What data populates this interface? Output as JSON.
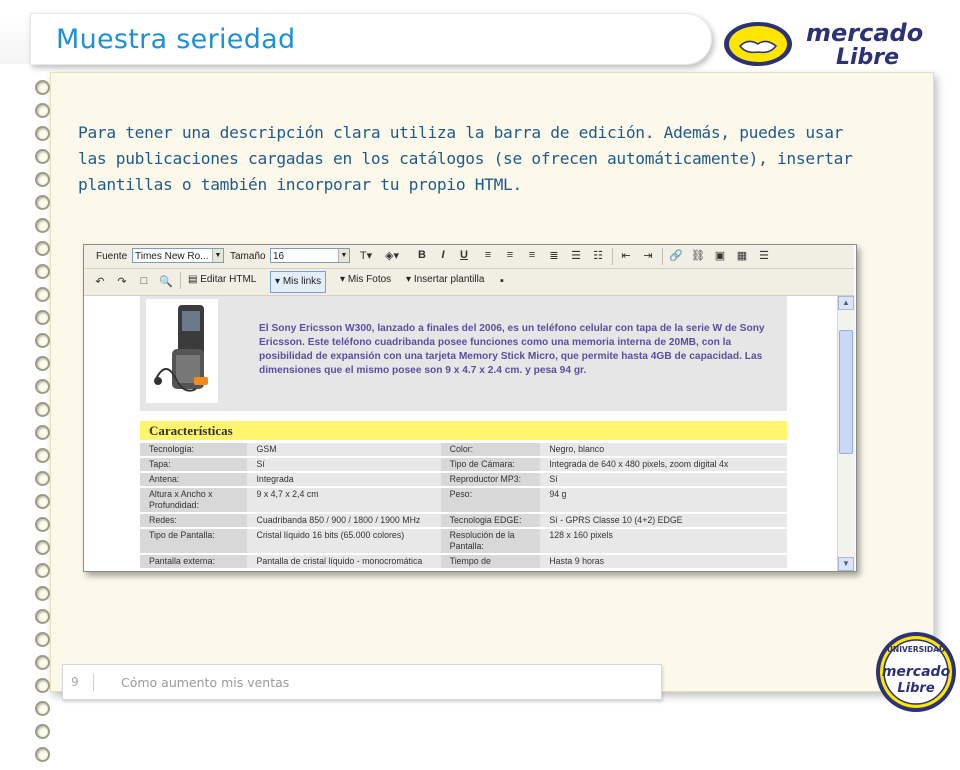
{
  "slide": {
    "title": "Muestra seriedad",
    "description": "Para tener una descripción clara utiliza la barra de edición. Además, puedes usar las publicaciones cargadas en los catálogos (se ofrecen automáticamente), insertar plantillas o también incorporar tu propio HTML.",
    "page_number": "9",
    "footer_title": "Cómo aumento mis ventas"
  },
  "logo": {
    "text_top": "mercado",
    "text_bottom": "Libre"
  },
  "badge": {
    "text_top": "UNIVERSIDAD",
    "text_mid": "mercado",
    "text_bottom": "Libre"
  },
  "editor": {
    "toolbar1": {
      "font_label": "Fuente",
      "font_value": "Times New Ro...",
      "size_label": "Tamaño",
      "size_value": "16"
    },
    "toolbar2": {
      "edit_html": "Editar HTML",
      "my_links": "Mis links",
      "my_photos": "Mis Fotos",
      "insert_template": "Insertar plantilla"
    },
    "intro_text": "El Sony Ericsson W300, lanzado a finales del 2006, es un teléfono celular con tapa de la serie W de Sony Ericsson. Este teléfono cuadribanda posee funciones como una memoria interna de 20MB, con la posibilidad de expansión con una tarjeta Memory Stick Micro, que permite hasta 4GB de capacidad. Las dimensiones que el mismo posee son 9 x 4.7 x 2.4 cm. y pesa 94 gr.",
    "characteristics_heading": "Características",
    "specs": [
      {
        "k1": "Tecnología:",
        "v1": "GSM",
        "k2": "Color:",
        "v2": "Negro, blanco"
      },
      {
        "k1": "Tapa:",
        "v1": "Sí",
        "k2": "Tipo de Cámara:",
        "v2": "Integrada de 640 x 480 pixels, zoom digital 4x"
      },
      {
        "k1": "Antena:",
        "v1": "Integrada",
        "k2": "Reproductor MP3:",
        "v2": "Sí"
      },
      {
        "k1": "Altura x Ancho x Profundidad:",
        "v1": "9 x 4,7 x 2,4 cm",
        "k2": "Peso:",
        "v2": "94 g"
      },
      {
        "k1": "Redes:",
        "v1": "Cuadribanda 850 / 900 / 1800 / 1900 MHz",
        "k2": "Tecnologia EDGE:",
        "v2": "Sí - GPRS Classe 10 (4+2) EDGE"
      },
      {
        "k1": "Tipo de Pantalla:",
        "v1": "Cristal líquido 16 bits (65.000 colores)",
        "k2": "Resolución de la Pantalla:",
        "v2": "128 x 160 pixels"
      },
      {
        "k1": "Pantalla externa:",
        "v1": "Pantalla de cristal líquido - monocromática",
        "k2": "Tiempo de",
        "v2": "Hasta 9 horas"
      }
    ]
  },
  "colors": {
    "title_blue": "#1f8fd6",
    "body_blue": "#1e5b8a",
    "page_bg": "#fdf9ea",
    "heading_yellow": "#fff56e",
    "brand_yellow": "#ffe600",
    "brand_navy": "#2d3277"
  }
}
